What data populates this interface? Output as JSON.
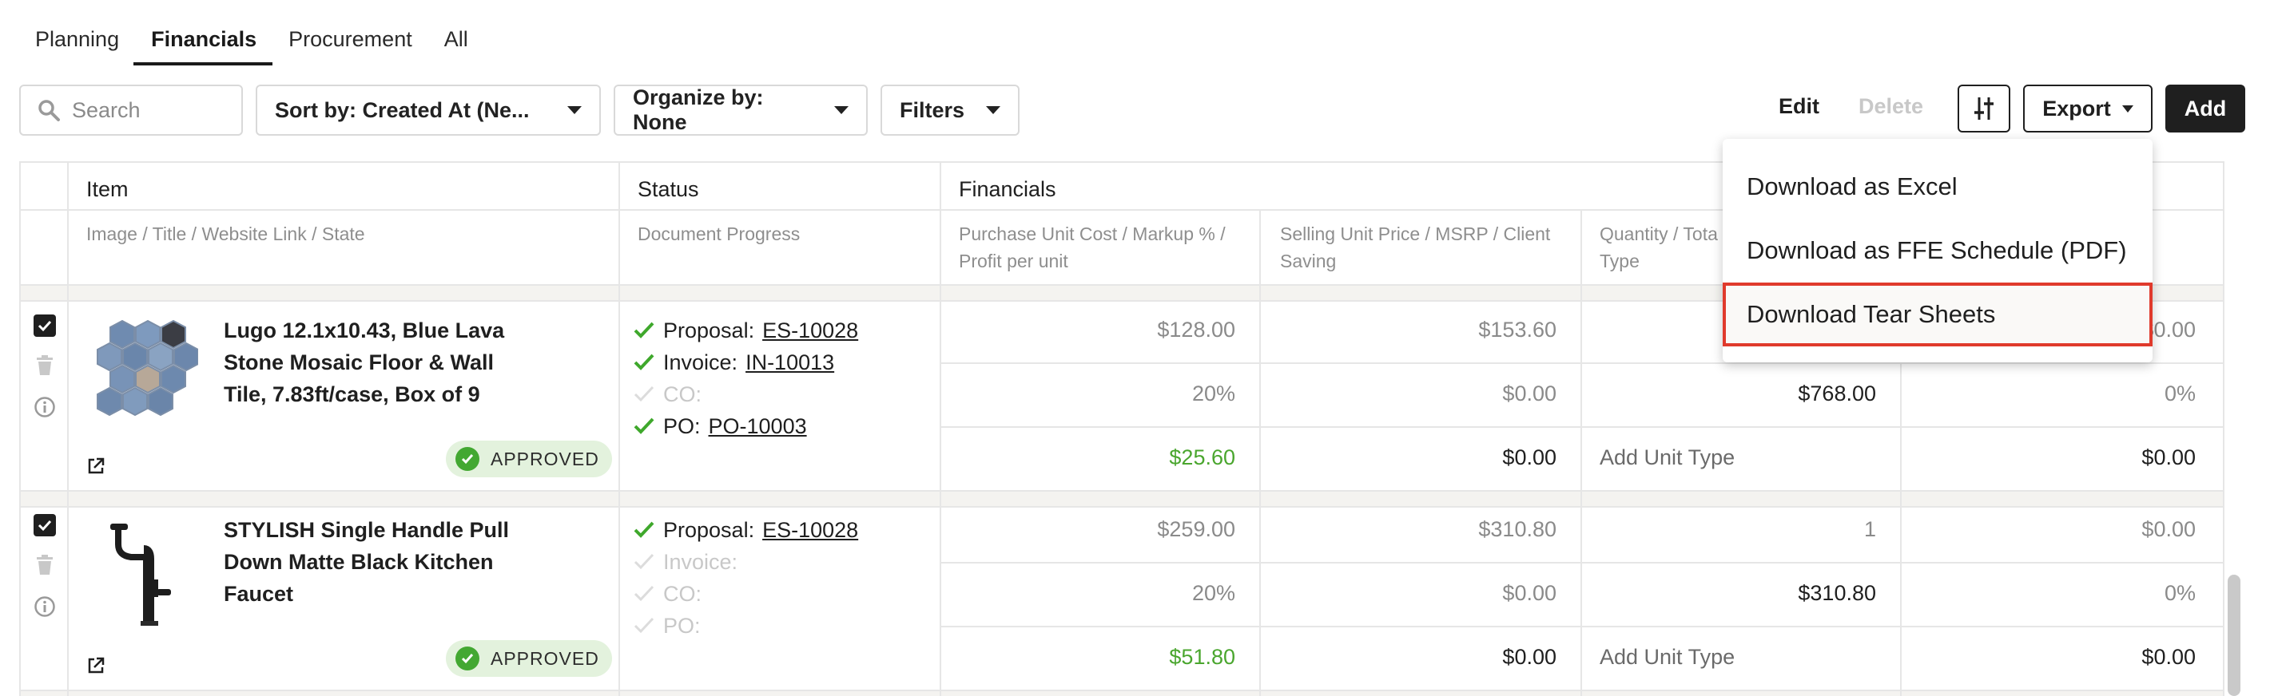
{
  "tabs": [
    {
      "label": "Planning"
    },
    {
      "label": "Financials"
    },
    {
      "label": "Procurement"
    },
    {
      "label": "All"
    }
  ],
  "toolbar": {
    "search_placeholder": "Search",
    "sort_label": "Sort by: Created At (Ne...",
    "organize_label": "Organize by: None",
    "filters_label": "Filters",
    "edit_label": "Edit",
    "delete_label": "Delete",
    "export_label": "Export",
    "add_label": "Add"
  },
  "export_menu": {
    "items": [
      {
        "label": "Download as Excel"
      },
      {
        "label": "Download as FFE Schedule (PDF)"
      },
      {
        "label": "Download Tear Sheets"
      }
    ],
    "highlighted_index": 2,
    "highlight_color": "#e03a2c"
  },
  "table": {
    "groups": {
      "item": "Item",
      "status": "Status",
      "financials": "Financials"
    },
    "subheaders": {
      "item": "Image / Title / Website Link / State",
      "status": "Document Progress",
      "purchase": "Purchase Unit Cost / Markup % / Profit per unit",
      "selling": "Selling Unit Price / MSRP / Client Saving",
      "quantity": "Quantity / Tota Unit Type"
    },
    "rows": [
      {
        "title": "Lugo 12.1x10.43, Blue Lava Stone Mosaic Floor & Wall Tile, 7.83ft/case, Box of 9",
        "state": "APPROVED",
        "docs": [
          {
            "label": "Proposal:",
            "ref": "ES-10028",
            "done": true
          },
          {
            "label": "Invoice:",
            "ref": "IN-10013",
            "done": true
          },
          {
            "label": "CO:",
            "ref": "",
            "done": false
          },
          {
            "label": "PO:",
            "ref": "PO-10003",
            "done": true
          }
        ],
        "purchase_cost": "$128.00",
        "markup": "20%",
        "profit": "$25.60",
        "selling_price": "$153.60",
        "msrp": "$0.00",
        "client_saving": "$0.00",
        "quantity": "",
        "total": "$768.00",
        "unit_type": "Add Unit Type",
        "col6_top": "$0.00",
        "col6_mid": "0%",
        "col6_bot": "$0.00"
      },
      {
        "title": "STYLISH Single Handle Pull Down Matte Black Kitchen Faucet",
        "state": "APPROVED",
        "docs": [
          {
            "label": "Proposal:",
            "ref": "ES-10028",
            "done": true
          },
          {
            "label": "Invoice:",
            "ref": "",
            "done": false
          },
          {
            "label": "CO:",
            "ref": "",
            "done": false
          },
          {
            "label": "PO:",
            "ref": "",
            "done": false
          }
        ],
        "purchase_cost": "$259.00",
        "markup": "20%",
        "profit": "$51.80",
        "selling_price": "$310.80",
        "msrp": "$0.00",
        "client_saving": "$0.00",
        "quantity": "1",
        "total": "$310.80",
        "unit_type": "Add Unit Type",
        "col6_top": "$0.00",
        "col6_mid": "0%",
        "col6_bot": "$0.00"
      }
    ]
  },
  "colors": {
    "accent_dark": "#1f1f1f",
    "approved_bg": "#e3f2dd",
    "approved_dot": "#43a832",
    "profit_green": "#4aa62e",
    "check_green": "#3fa82c"
  }
}
